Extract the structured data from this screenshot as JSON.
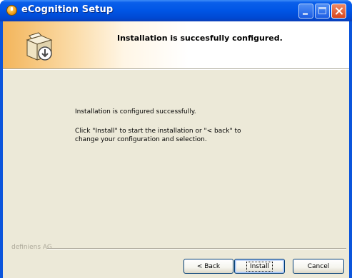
{
  "window": {
    "title": "eCognition Setup",
    "buttons": [
      "minimize-icon",
      "maximize-icon",
      "close-icon"
    ]
  },
  "header": {
    "title": "Installation is succesfully configured.",
    "icon": "install-box-icon"
  },
  "body": {
    "line1": "Installation is configured successfully.",
    "line2": "Click \"Install\" to start the installation or \"< back\" to change your configuration and selection."
  },
  "footer": {
    "brand": "definiens AG",
    "back_label": "< Back",
    "install_label": "Install",
    "cancel_label": "Cancel"
  },
  "colors": {
    "titlebar": "#0055e5",
    "dialog": "#ece9d8",
    "header_accent": "#f3b55b"
  }
}
